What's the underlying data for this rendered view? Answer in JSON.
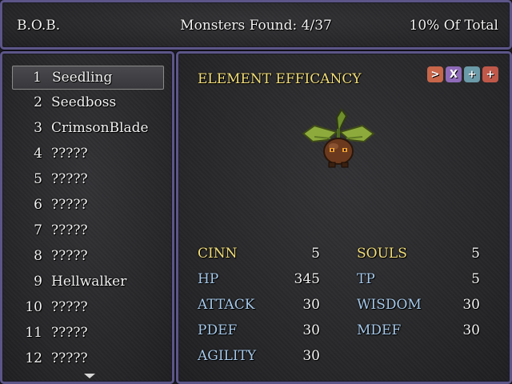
{
  "header": {
    "title": "B.O.B.",
    "monsters_found": "Monsters Found: 4/37",
    "percent_total": "10% Of Total"
  },
  "list": {
    "items": [
      {
        "num": "1",
        "name": "Seedling"
      },
      {
        "num": "2",
        "name": "Seedboss"
      },
      {
        "num": "3",
        "name": "CrimsonBlade"
      },
      {
        "num": "4",
        "name": "?????"
      },
      {
        "num": "5",
        "name": "?????"
      },
      {
        "num": "6",
        "name": "?????"
      },
      {
        "num": "7",
        "name": "?????"
      },
      {
        "num": "8",
        "name": "?????"
      },
      {
        "num": "9",
        "name": "Hellwalker"
      },
      {
        "num": "10",
        "name": "?????"
      },
      {
        "num": "11",
        "name": "?????"
      },
      {
        "num": "12",
        "name": "?????"
      }
    ],
    "selected_index": 0
  },
  "detail": {
    "section_title": "ELEMENT EFFICANCY",
    "element_icons": [
      {
        "name": "fire-element-icon",
        "glyph": ">",
        "color": "#c8664a"
      },
      {
        "name": "wind-element-icon",
        "glyph": "X",
        "color": "#8e6ab8"
      },
      {
        "name": "earth-element-icon",
        "glyph": "+",
        "color": "#6b9aa8"
      },
      {
        "name": "light-element-icon",
        "glyph": "+",
        "color": "#c0584a"
      }
    ],
    "stats_left": [
      {
        "label": "CINN",
        "value": "5",
        "highlight": true
      },
      {
        "label": "HP",
        "value": "345",
        "highlight": false
      },
      {
        "label": "ATTACK",
        "value": "30",
        "highlight": false
      },
      {
        "label": "PDEF",
        "value": "30",
        "highlight": false
      },
      {
        "label": "AGILITY",
        "value": "30",
        "highlight": false
      }
    ],
    "stats_right": [
      {
        "label": "SOULS",
        "value": "5",
        "highlight": true
      },
      {
        "label": "TP",
        "value": "5",
        "highlight": false
      },
      {
        "label": "WISDOM",
        "value": "30",
        "highlight": false
      },
      {
        "label": "MDEF",
        "value": "30",
        "highlight": false
      }
    ]
  },
  "colors": {
    "gold": "#f3df7a",
    "blue": "#a6c9ea",
    "border": "#5c5688"
  }
}
